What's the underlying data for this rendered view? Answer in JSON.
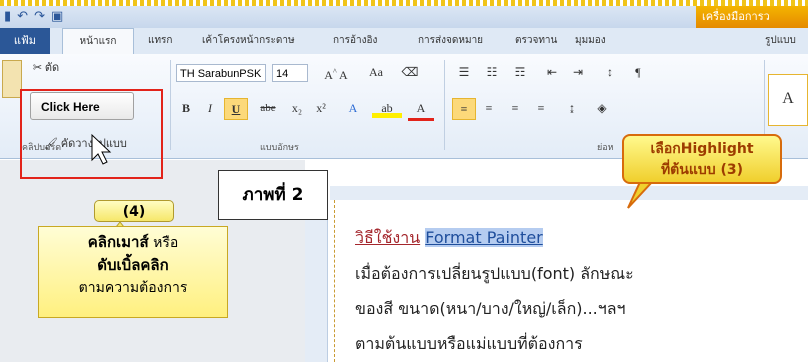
{
  "window": {
    "context_tab": "เครื่องมือการว",
    "quick_access": [
      "save-icon",
      "undo-icon",
      "redo-icon",
      "print-preview-icon"
    ]
  },
  "tabs": [
    "แฟ้ม",
    "หน้าแรก",
    "แทรก",
    "เค้าโครงหน้ากระดาษ",
    "การอ้างอิง",
    "การส่งจดหมาย",
    "ตรวจทาน",
    "มุมมอง",
    "รูปแบบ"
  ],
  "ribbon": {
    "clipboard": {
      "cut_label": "ตัด",
      "format_painter_label": "คัดวางรูปแบบ",
      "group_label": "คลิปบอร์ด"
    },
    "font": {
      "font_name": "TH SarabunPSK",
      "font_size": "14",
      "group_label": "แบบอักษร"
    },
    "paragraph": {
      "group_label": "ย่อห"
    },
    "styles": {
      "preview_char": "A"
    }
  },
  "annotations": {
    "click_here": "Click Here",
    "picture_label": "ภาพที่ 2",
    "step4_label": "(4)",
    "step4_line1": "คลิกเมาส์",
    "step4_line1b": " หรือ",
    "step4_line2": "ดับเบิ้ลคลิก",
    "step4_line3": "ตามความต้องการ",
    "step3_line1": "เลือกHighlight",
    "step3_line2": "ที่ต้นแบบ (3)"
  },
  "document": {
    "title_part1": "วิธีใช้งาน",
    "title_part2": "Format Painter",
    "line1": "เมื่อต้องการเปลี่ยนรูปแบบ(font) ลักษณะ",
    "line2": "ของสี ขนาด(หนา/บาง/ใหญ่/เล็ก)...ฯลฯ",
    "line3": "ตามต้นแบบหรือแม่แบบที่ต้องการ"
  }
}
